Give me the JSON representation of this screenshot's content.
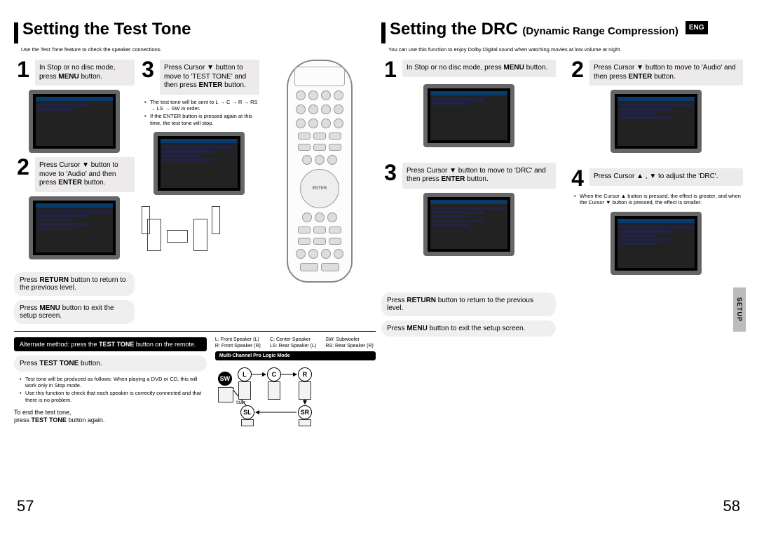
{
  "left": {
    "title": "Setting the Test Tone",
    "intro": "Use the Test Tone feature to check the speaker connections.",
    "steps": {
      "s1": "In Stop or no disc mode, press <b>MENU</b> button.",
      "s2": "Press Cursor ▼ button to move to 'Audio' and then press <b>ENTER</b> button.",
      "s3": "Press Cursor ▼ button to move to 'TEST TONE' and then press <b>ENTER</b> button.",
      "s3_note1": "The test tone will be sent to L → C → R → RS → LS → SW in order.",
      "s3_note2": "If the ENTER button is pressed again at this time, the test tone will stop."
    },
    "return_line": "Press <b>RETURN</b> button to return to the previous level.",
    "menu_line": "Press <b>MENU</b> button to exit the setup screen."
  },
  "alt_method": "Alternate method: press the <b>TEST TONE</b> button on the remote.",
  "test_tone_btn": "Press <b>TEST TONE</b> button.",
  "tt_notes": {
    "n1": "Test tone will be produced as follows: When playing a DVD or CD, this will work only in Stop mode.",
    "n2": "Use this function to check that each speaker is correctly connected and that there is no problem."
  },
  "tt_end": {
    "a": "To end the test tone,",
    "b": "press <b>TEST TONE</b> button again."
  },
  "speaker_key": {
    "L": "L: Front Speaker (L)",
    "C": "C: Center Speaker",
    "SW": "SW: Subwoofer",
    "R": "R: Front Speaker (R)",
    "LS": "LS: Rear Speaker (L)",
    "RS": "RS: Rear Speaker (R)"
  },
  "mcpl": "Multi-Channel Pro Logic Mode",
  "flow_labels": {
    "SW": "SW",
    "L": "L",
    "C": "C",
    "R": "R",
    "SL": "SL",
    "SR": "SR",
    "start": "Start"
  },
  "page_left": "57",
  "right": {
    "title_a": "Setting the DRC ",
    "title_b": "(Dynamic Range Compression)",
    "eng": "ENG",
    "intro": "You can use this function to enjoy Dolby Digital sound when watching movies at low volume at night.",
    "steps": {
      "s1": "In Stop or no disc mode, press <b>MENU</b> button.",
      "s2": "Press Cursor ▼ button to move to 'Audio' and then press <b>ENTER</b> button.",
      "s3": "Press Cursor ▼ button to move to 'DRC' and then press <b>ENTER</b> button.",
      "s4": "Press Cursor ▲ , ▼ to adjust the 'DRC'.",
      "s4_note": "When the Cursor ▲ button is pressed, the effect is greater, and when the Cursor ▼ button is pressed, the effect is smaller."
    },
    "return_line": "Press <b>RETURN</b> button to return to the previous level.",
    "menu_line": "Press <b>MENU</b> button to exit the setup screen.",
    "tab": "SETUP"
  },
  "page_right": "58"
}
